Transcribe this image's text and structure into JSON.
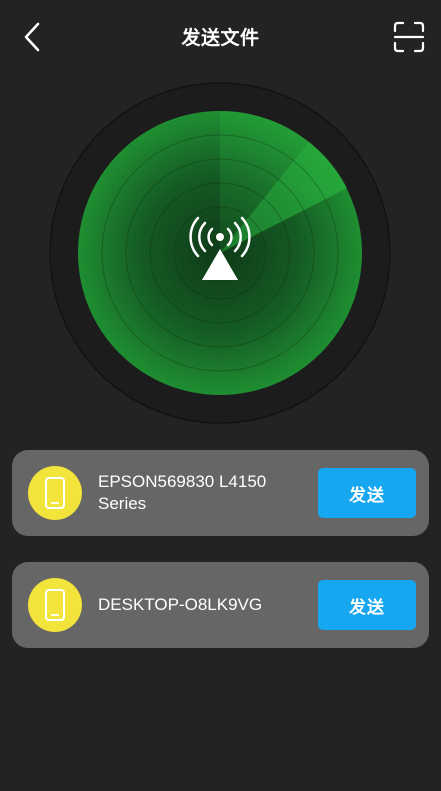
{
  "header": {
    "title": "发送文件",
    "back_icon": "chevron-left-icon",
    "scan_icon": "scan-frame-icon"
  },
  "radar": {
    "icon": "wifi-signal-icon",
    "center_icon": "triangle-icon",
    "color_fill": "#1f8e31",
    "color_ring": "#111111"
  },
  "devices": [
    {
      "name": "EPSON569830 L4150 Series",
      "button_label": "发送",
      "icon": "phone-icon"
    },
    {
      "name": "DESKTOP-O8LK9VG",
      "button_label": "发送",
      "icon": "phone-icon"
    }
  ],
  "colors": {
    "background": "#232323",
    "card": "#666666",
    "avatar": "#f2e43a",
    "button": "#16a7f0"
  }
}
